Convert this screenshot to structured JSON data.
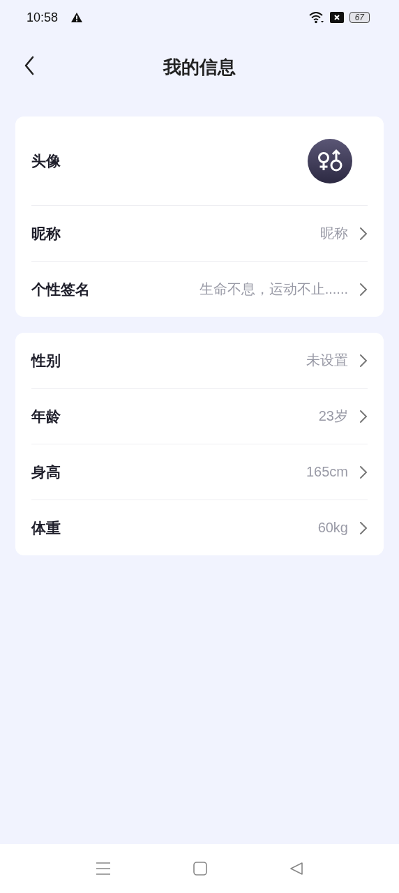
{
  "status_bar": {
    "time": "10:58",
    "battery": "67"
  },
  "header": {
    "title": "我的信息"
  },
  "profile_card": {
    "avatar": {
      "label": "头像"
    },
    "rows": [
      {
        "label": "昵称",
        "value": "昵称"
      },
      {
        "label": "个性签名",
        "value": "生命不息，运动不止......"
      }
    ]
  },
  "details_card": {
    "rows": [
      {
        "label": "性别",
        "value": "未设置"
      },
      {
        "label": "年龄",
        "value": "23岁"
      },
      {
        "label": "身高",
        "value": "165cm"
      },
      {
        "label": "体重",
        "value": "60kg"
      }
    ]
  }
}
